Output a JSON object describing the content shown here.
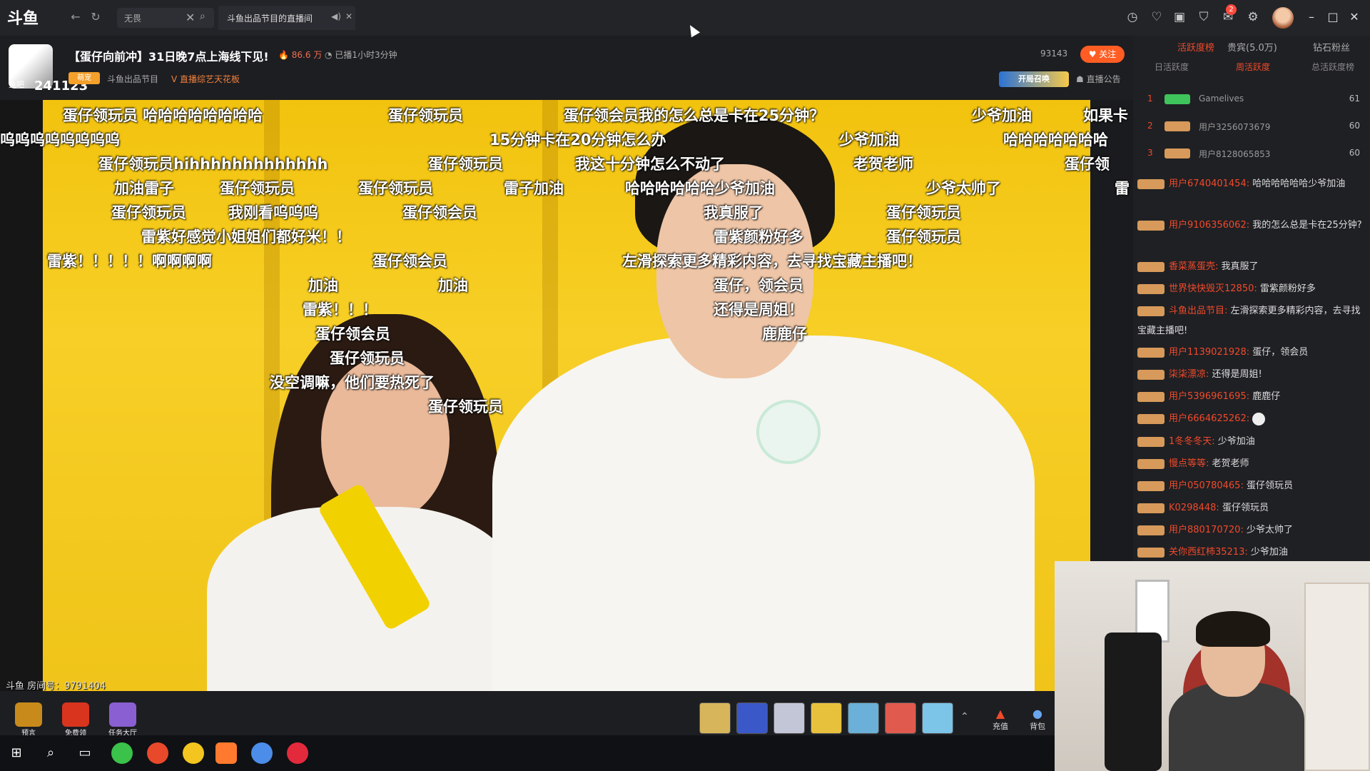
{
  "topbar": {
    "logo": "斗鱼",
    "search_text": "无畏",
    "tab_title": "斗鱼出品节目的直播间",
    "notification_count": "2"
  },
  "room": {
    "level": "鱼吧",
    "id_big": "241123",
    "title": "【蛋仔向前冲】31日晚7点上海线下见!",
    "heat": "86.6 万",
    "duration": "已播1小时3分钟",
    "tag": "萌宠",
    "category": "斗鱼出品节目",
    "rank": "直播综艺天花板",
    "fans": "93143",
    "follow": "关注",
    "gold_btn": "开局召唤",
    "notice": "直播公告",
    "room_number": "斗鱼 房间号：9791404"
  },
  "danmaku": [
    "蛋仔领玩员 哈哈哈哈哈哈哈哈",
    "蛋仔领玩员",
    "蛋仔领会员我的怎么总是卡在25分钟？",
    "少爷加油",
    "如果卡",
    "呜呜呜呜呜呜呜呜",
    "15分钟卡在20分钟怎么办",
    "少爷加油",
    "哈哈哈哈哈哈哈",
    "蛋仔领玩员hihhhhhhhhhhhhh",
    "蛋仔领玩员",
    "我这十分钟怎么不动了",
    "老贺老师",
    "蛋仔领",
    "加油雷子",
    "蛋仔领玩员",
    "蛋仔领玩员",
    "雷子加油",
    "哈哈哈哈哈哈少爷加油",
    "少爷太帅了",
    "雷",
    "蛋仔领玩员",
    "我刚看呜呜呜",
    "蛋仔领会员",
    "我真服了",
    "蛋仔领玩员",
    "雷紫好感觉小姐姐们都好米！！",
    "雷紫颜粉好多",
    "蛋仔领玩员",
    "雷紫！！！！！啊啊啊啊",
    "蛋仔领会员",
    "左滑探索更多精彩内容，去寻找宝藏主播吧！",
    "加油",
    "加油",
    "蛋仔，领会员",
    "雷紫！！！",
    "还得是周姐！",
    "蛋仔领会员",
    "鹿鹿仔",
    "蛋仔领玩员",
    "没空调嘛，他们要热死了",
    "蛋仔领玩员"
  ],
  "bottombar": {
    "items": [
      {
        "label": "预言",
        "icon": "trophy-icon"
      },
      {
        "label": "免费领",
        "icon": "fire-icon"
      },
      {
        "label": "任务大厅",
        "icon": "task-icon"
      }
    ],
    "recharge": "充值",
    "backpack": "背包"
  },
  "right_panel": {
    "tabs": [
      "活跃度榜",
      "贵宾(5.0万)",
      "钻石粉丝"
    ],
    "subtabs": [
      "日活跃度",
      "周活跃度",
      "总活跃度榜"
    ],
    "ranks": [
      {
        "num": "1",
        "name": "Gamelives",
        "score": "61"
      },
      {
        "num": "2",
        "name": "用户3256073679",
        "score": "60"
      },
      {
        "num": "3",
        "name": "用户8128065853",
        "score": "60"
      }
    ],
    "chats": [
      {
        "user": "用户6740401454:",
        "text": "哈哈哈哈哈哈少爷加油"
      },
      {
        "user": "用户9106356062:",
        "text": "我的怎么总是卡在25分钟?"
      },
      {
        "user": "香菜蒸蛋壳:",
        "text": "我真服了"
      },
      {
        "user": "世界快快毁灭12850:",
        "text": "雷紫颜粉好多"
      },
      {
        "user": "斗鱼出品节目:",
        "text": "左滑探索更多精彩内容，去寻找宝藏主播吧!"
      },
      {
        "user": "用户1139021928:",
        "text": "蛋仔，领会员"
      },
      {
        "user": "柒柒漂凉:",
        "text": "还得是周姐!"
      },
      {
        "user": "用户5396961695:",
        "text": "鹿鹿仔"
      },
      {
        "user": "用户6664625262:",
        "text": ""
      },
      {
        "user": "1冬冬冬天:",
        "text": "少爷加油"
      },
      {
        "user": "慢点等等:",
        "text": "老贺老师"
      },
      {
        "user": "用户050780465:",
        "text": "蛋仔领玩员"
      },
      {
        "user": "K0298448:",
        "text": "蛋仔领玩员"
      },
      {
        "user": "用户880170720:",
        "text": "少爷太帅了"
      },
      {
        "user": "关你西红柿35213:",
        "text": "少爷加油"
      }
    ]
  }
}
